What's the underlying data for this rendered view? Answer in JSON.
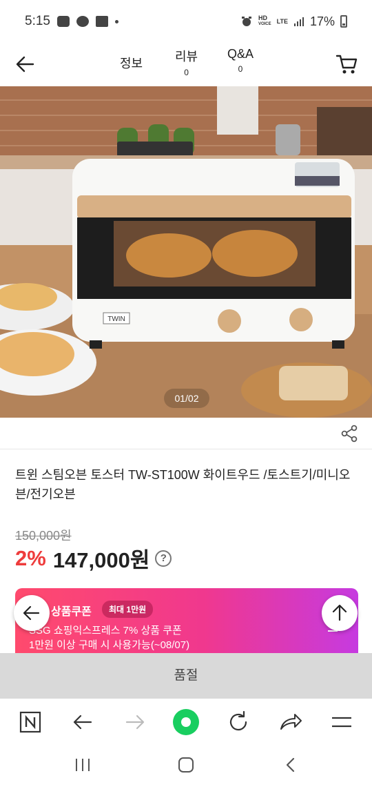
{
  "status_bar": {
    "time": "5:15",
    "network": "HD",
    "network_sub": "VOICE",
    "lte": "LTE",
    "battery": "17%"
  },
  "header": {
    "tabs": [
      {
        "label": "정보",
        "count": ""
      },
      {
        "label": "리뷰",
        "count": "0"
      },
      {
        "label": "Q&A",
        "count": "0"
      }
    ]
  },
  "product": {
    "image_counter": "01/02",
    "title": "트윈 스팀오븐 토스터 TW-ST100W 화이트우드 /토스트기/미니오븐/전기오븐",
    "original_price": "150,000원",
    "discount": "2%",
    "price": "147,000원",
    "help": "?",
    "oven_brand": "TWIN"
  },
  "coupon": {
    "title": "상품쿠폰",
    "badge": "최대 1만원",
    "line1": "SSG 쇼핑익스프레스 7% 상품 쿠폰",
    "line2": "1만원 이상 구매 시 사용가능(~08/07)"
  },
  "soldout": {
    "label": "품절"
  },
  "colors": {
    "discount": "#ee3c3c",
    "coupon_start": "#ff4a6d",
    "coupon_end": "#c63ae0",
    "soldout_bg": "#d9d9d9",
    "browser_green": "#19ce60"
  },
  "icons": {
    "back": "arrow-left-icon",
    "cart": "cart-icon",
    "share": "share-icon",
    "browser_home": "naver-n-icon",
    "browser_back": "arrow-left-icon",
    "browser_forward": "arrow-right-icon",
    "browser_green": "green-circle-icon",
    "browser_refresh": "refresh-icon",
    "browser_share": "forward-share-icon",
    "browser_menu": "hamburger-icon"
  }
}
